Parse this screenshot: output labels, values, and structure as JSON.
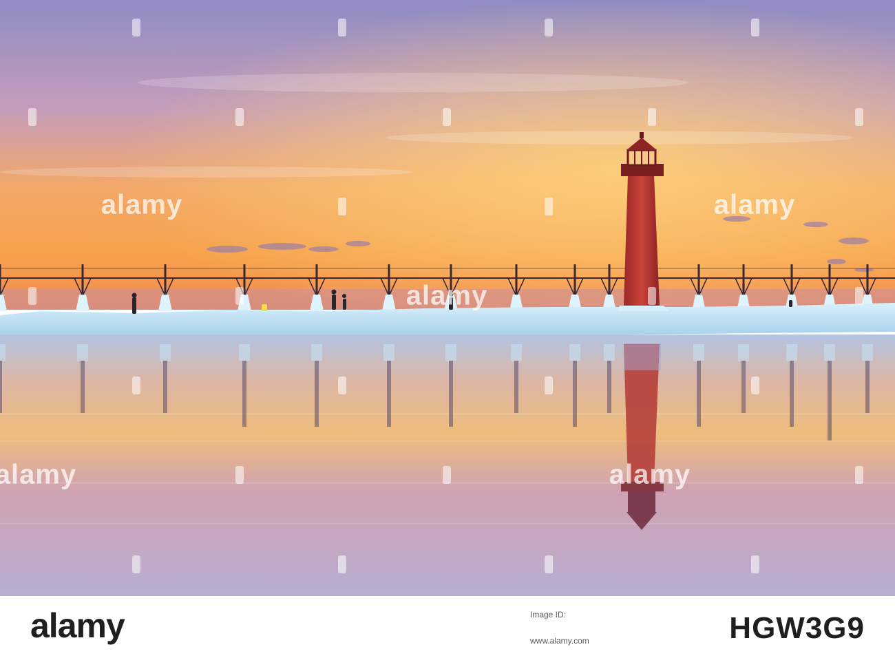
{
  "watermark": {
    "text": "alamy"
  },
  "footer": {
    "logo": "alamy",
    "id_label": "Image ID:",
    "image_id": "HGW3G9",
    "url": "www.alamy.com"
  },
  "colors": {
    "sky_top": "#8a86c0",
    "sky_glow": "#f6a24a",
    "lighthouse": "#b8332c",
    "ice": "#bfe3f6",
    "water_top": "#b9b7d9",
    "water_mid": "#e9ba7c"
  }
}
